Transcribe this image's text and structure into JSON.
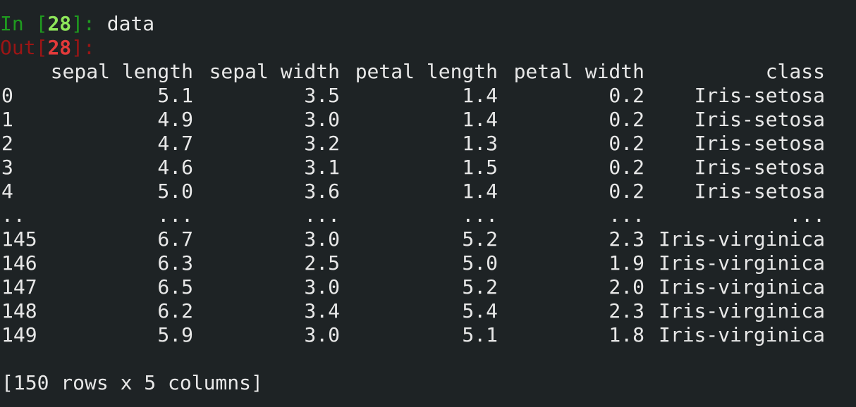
{
  "input": {
    "prompt_label": "In ",
    "prompt_open": "[",
    "prompt_number": "28",
    "prompt_close": "]: ",
    "code": "data"
  },
  "output": {
    "prompt_label": "Out",
    "prompt_open": "[",
    "prompt_number": "28",
    "prompt_close": "]:"
  },
  "table": {
    "columns": [
      "sepal length",
      "sepal width",
      "petal length",
      "petal width",
      "class"
    ],
    "rows": [
      {
        "index": "0",
        "values": [
          "5.1",
          "3.5",
          "1.4",
          "0.2",
          "Iris-setosa"
        ]
      },
      {
        "index": "1",
        "values": [
          "4.9",
          "3.0",
          "1.4",
          "0.2",
          "Iris-setosa"
        ]
      },
      {
        "index": "2",
        "values": [
          "4.7",
          "3.2",
          "1.3",
          "0.2",
          "Iris-setosa"
        ]
      },
      {
        "index": "3",
        "values": [
          "4.6",
          "3.1",
          "1.5",
          "0.2",
          "Iris-setosa"
        ]
      },
      {
        "index": "4",
        "values": [
          "5.0",
          "3.6",
          "1.4",
          "0.2",
          "Iris-setosa"
        ]
      },
      {
        "index": "..",
        "values": [
          "...",
          "...",
          "...",
          "...",
          "..."
        ]
      },
      {
        "index": "145",
        "values": [
          "6.7",
          "3.0",
          "5.2",
          "2.3",
          "Iris-virginica"
        ]
      },
      {
        "index": "146",
        "values": [
          "6.3",
          "2.5",
          "5.0",
          "1.9",
          "Iris-virginica"
        ]
      },
      {
        "index": "147",
        "values": [
          "6.5",
          "3.0",
          "5.2",
          "2.0",
          "Iris-virginica"
        ]
      },
      {
        "index": "148",
        "values": [
          "6.2",
          "3.4",
          "5.4",
          "2.3",
          "Iris-virginica"
        ]
      },
      {
        "index": "149",
        "values": [
          "5.9",
          "3.0",
          "5.1",
          "1.8",
          "Iris-virginica"
        ]
      }
    ],
    "summary": "[150 rows x 5 columns]"
  },
  "colors": {
    "background": "#1e2325",
    "text": "#e8e8e8",
    "in_prompt": "#1f9b1f",
    "in_prompt_number": "#8ee65a",
    "out_prompt": "#9b1515",
    "out_prompt_number": "#e33a3a"
  }
}
